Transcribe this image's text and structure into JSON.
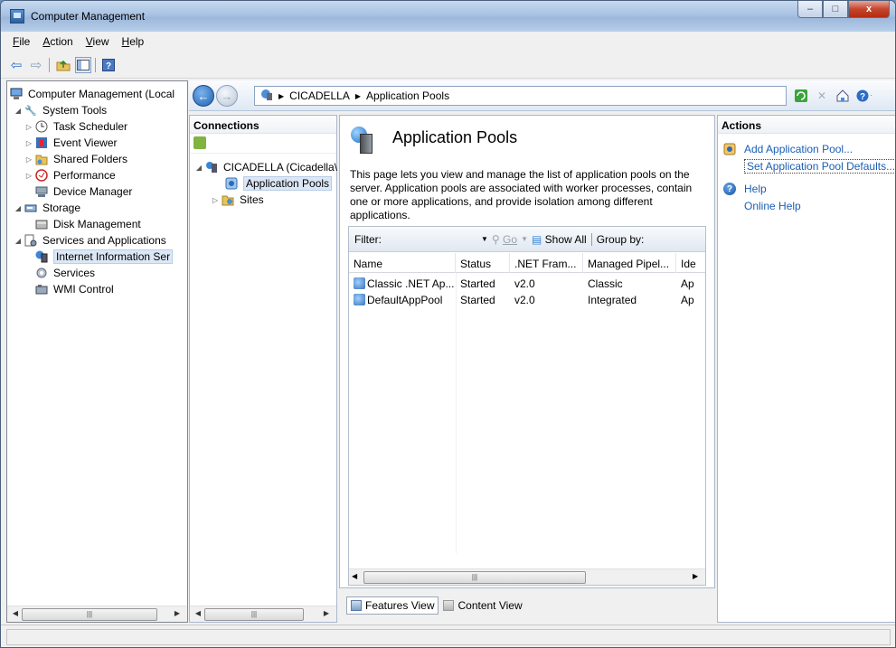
{
  "window": {
    "title": "Computer Management",
    "minimize": "–",
    "maximize": "□",
    "close": "x"
  },
  "menu": [
    {
      "label": "File",
      "key": "F",
      "rest": "ile"
    },
    {
      "label": "Action",
      "key": "A",
      "rest": "ction"
    },
    {
      "label": "View",
      "key": "V",
      "rest": "iew"
    },
    {
      "label": "Help",
      "key": "H",
      "rest": "elp"
    }
  ],
  "toolbar": {
    "icons": [
      "back-arrow-icon",
      "forward-arrow-icon",
      "up-folder-icon",
      "show-hide-tree-icon",
      "help-icon"
    ]
  },
  "tree": {
    "root": "Computer Management (Local",
    "system_tools": "System Tools",
    "task_scheduler": "Task Scheduler",
    "event_viewer": "Event Viewer",
    "shared_folders": "Shared Folders",
    "performance": "Performance",
    "device_manager": "Device Manager",
    "storage": "Storage",
    "disk_management": "Disk Management",
    "services_apps": "Services and Applications",
    "iis": "Internet Information Ser",
    "services": "Services",
    "wmi": "WMI Control"
  },
  "address": {
    "server": "CICADELLA",
    "page": "Application Pools"
  },
  "connections": {
    "header": "Connections",
    "server_node": "CICADELLA (Cicadella\\",
    "app_pools": "Application Pools",
    "sites": "Sites"
  },
  "main": {
    "title": "Application Pools",
    "description": "This page lets you view and manage the list of application pools on the server. Application pools are associated with worker processes, contain one or more applications, and provide isolation among different applications.",
    "filter_label": "Filter:",
    "go": "Go",
    "show_all": "Show All",
    "group_by": "Group by:",
    "columns": [
      "Name",
      "Status",
      ".NET Fram...",
      "Managed Pipel...",
      "Ide"
    ],
    "rows": [
      {
        "name": "Classic .NET Ap...",
        "status": "Started",
        "net": "v2.0",
        "pipeline": "Classic",
        "identity": "Ap"
      },
      {
        "name": "DefaultAppPool",
        "status": "Started",
        "net": "v2.0",
        "pipeline": "Integrated",
        "identity": "Ap"
      }
    ],
    "features_view": "Features View",
    "content_view": "Content View"
  },
  "actions": {
    "header": "Actions",
    "add_pool": "Add Application Pool...",
    "set_defaults": "Set Application Pool Defaults...",
    "help": "Help",
    "online_help": "Online Help"
  },
  "colors": {
    "link": "#1a5fb4",
    "titlebar": "#a9c3e3",
    "selection": "#dce7f5"
  }
}
